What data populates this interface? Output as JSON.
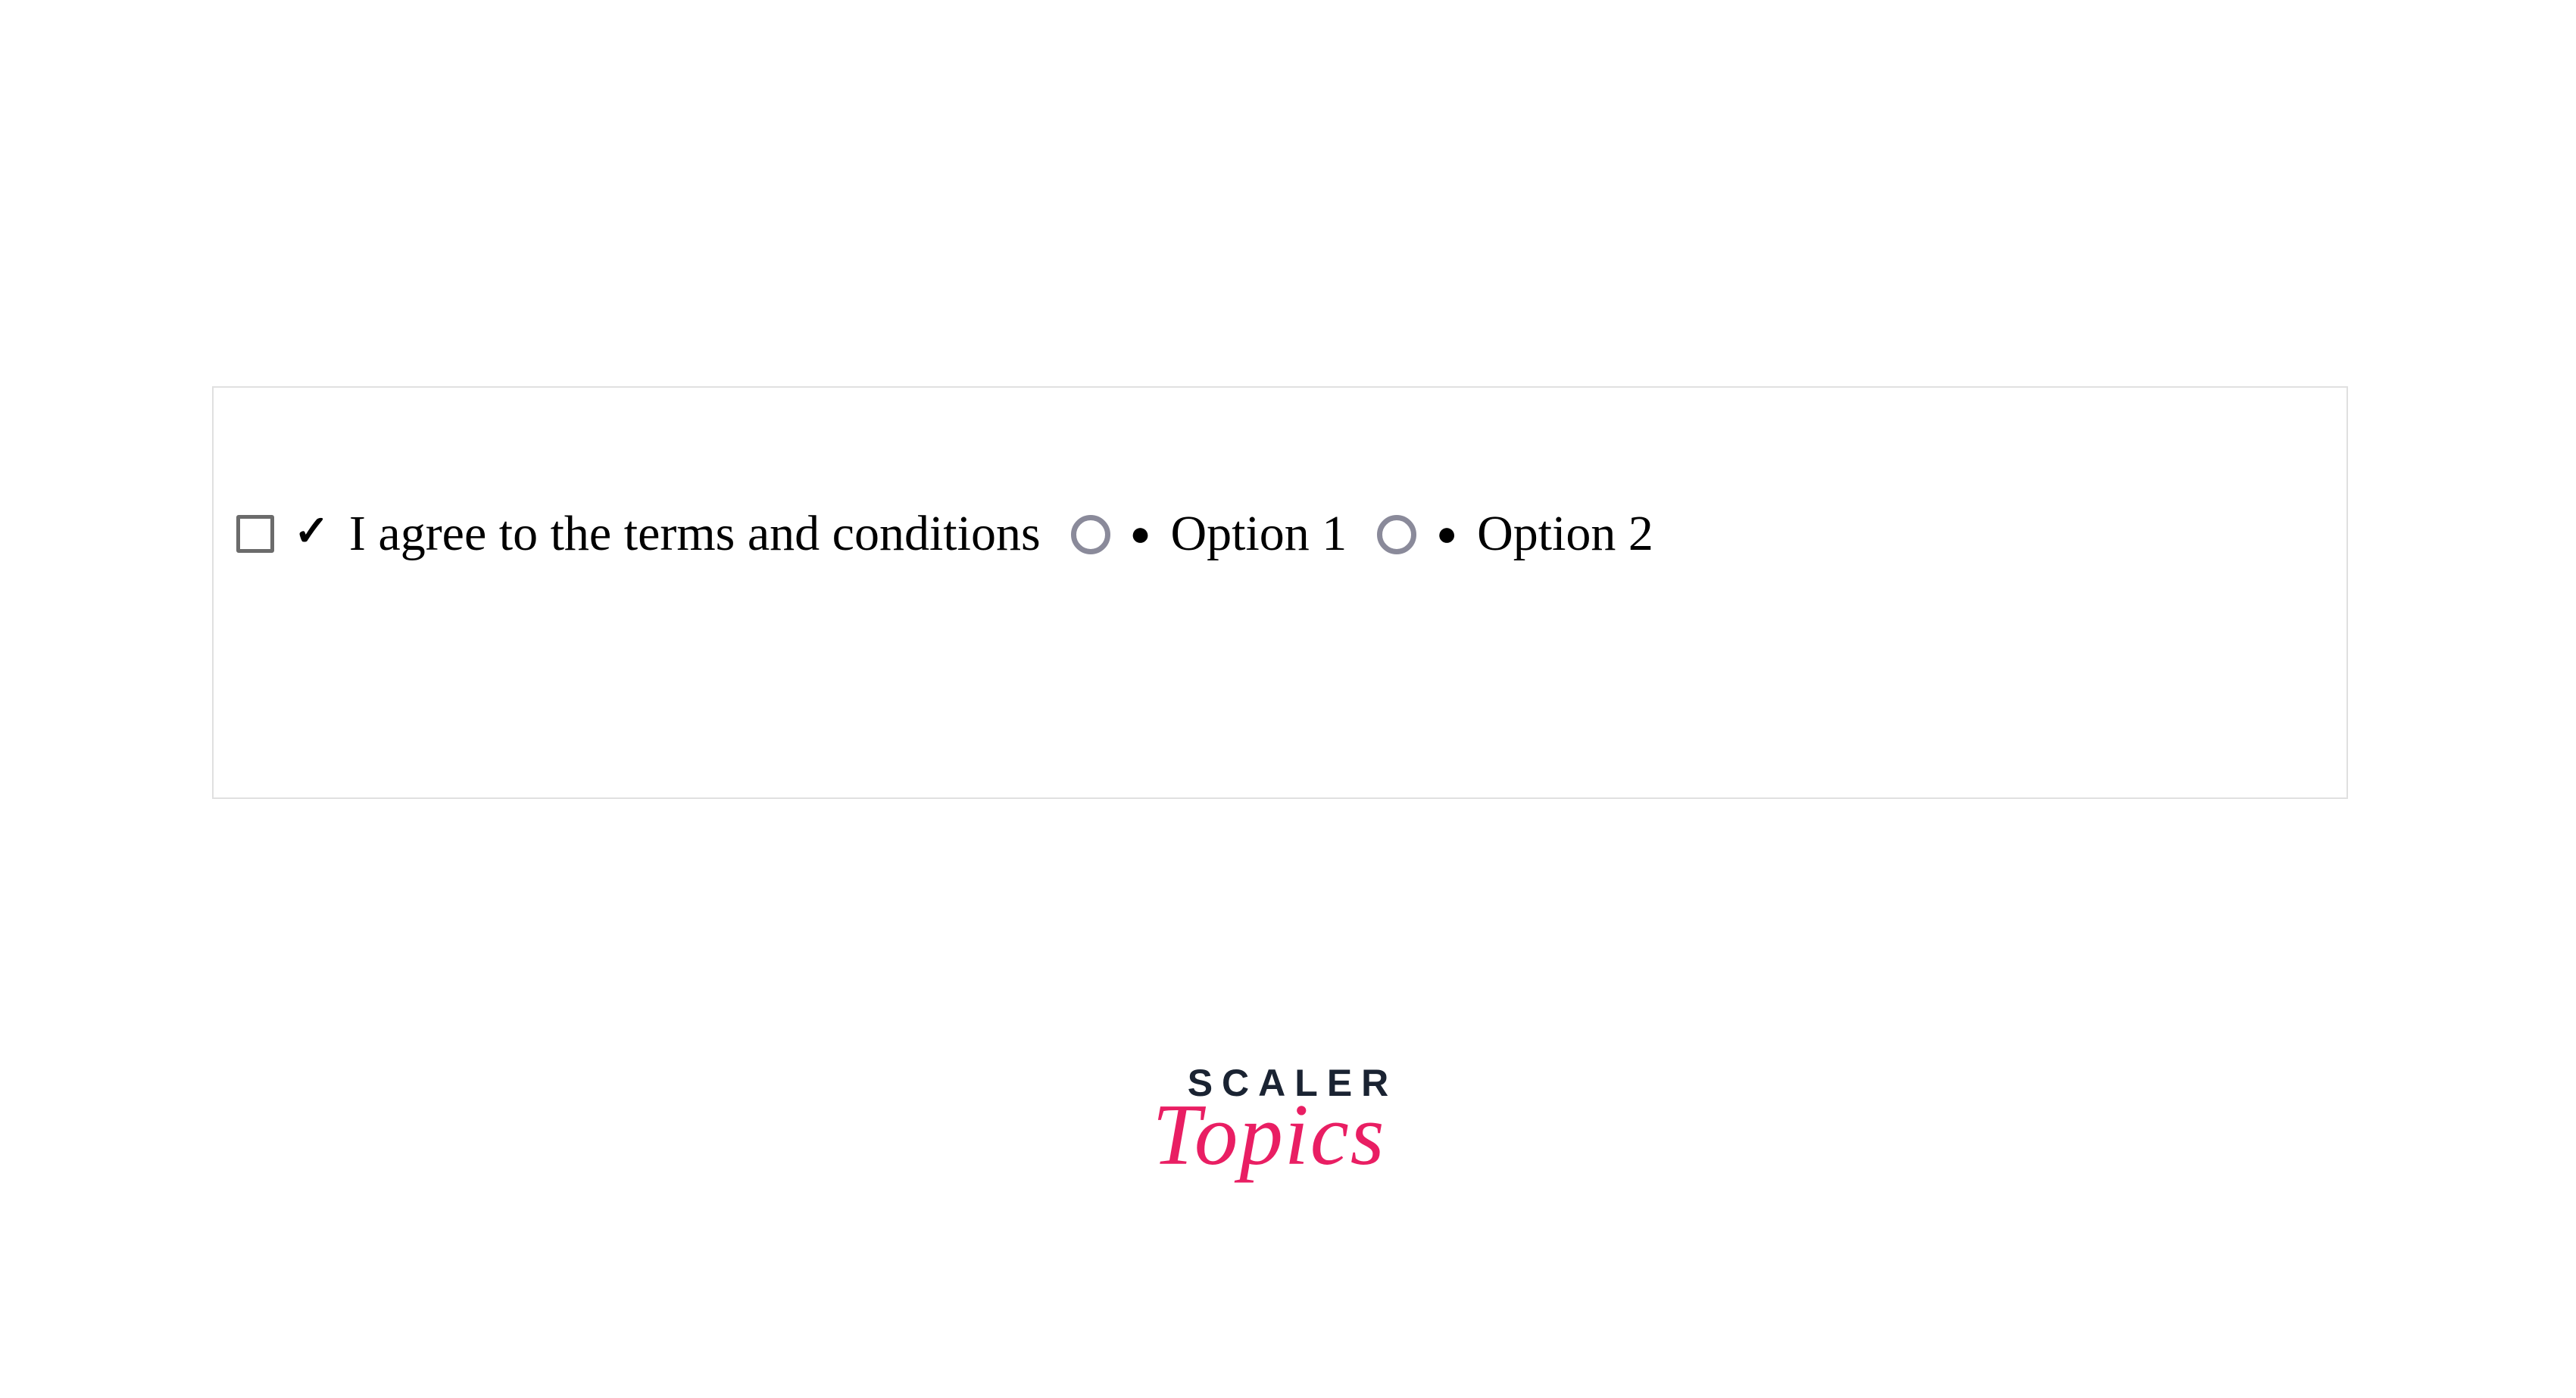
{
  "form": {
    "checkbox": {
      "bullet": "✓",
      "label": "I agree to the terms and conditions"
    },
    "radios": [
      {
        "bullet": "●",
        "label": "Option 1"
      },
      {
        "bullet": "●",
        "label": "Option 2"
      }
    ]
  },
  "logo": {
    "line1": "SCALER",
    "line2": "Topics"
  }
}
